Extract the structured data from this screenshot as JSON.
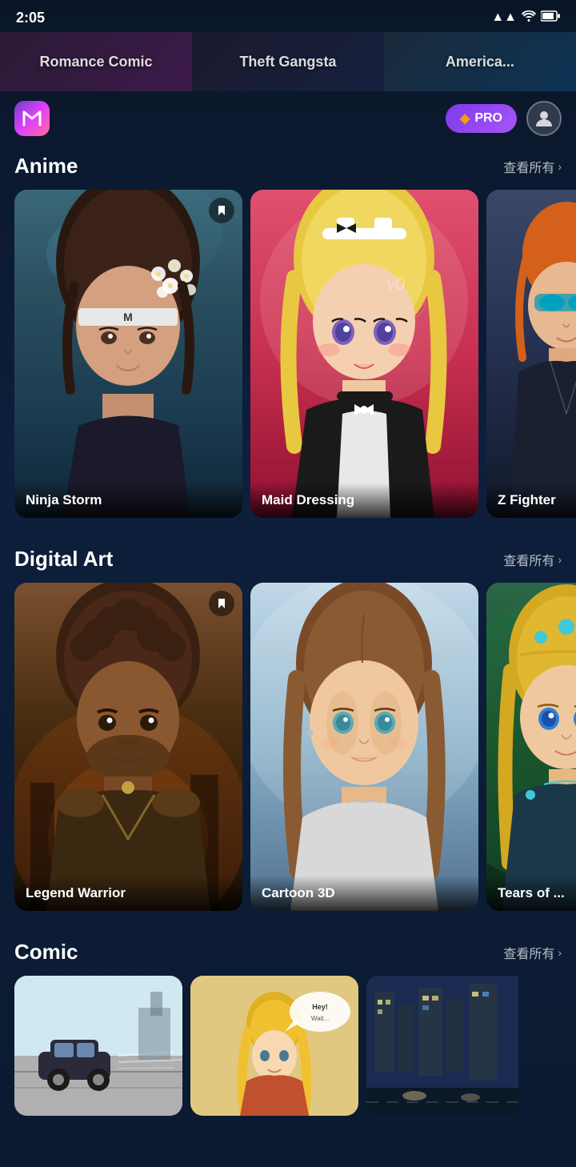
{
  "statusBar": {
    "time": "2:05",
    "signal": "▲",
    "wifi": "wifi",
    "battery": "🔋"
  },
  "topBanners": [
    {
      "label": "Romance Comic"
    },
    {
      "label": "Theft Gangsta"
    },
    {
      "label": "America..."
    }
  ],
  "header": {
    "logoText": "M",
    "proBadge": "PRO",
    "avatarLabel": "User"
  },
  "sections": [
    {
      "id": "anime",
      "title": "Anime",
      "viewAllLabel": "查看所有",
      "cards": [
        {
          "name": "Ninja Storm",
          "cardStyle": "ninja"
        },
        {
          "name": "Maid Dressing",
          "cardStyle": "maid"
        },
        {
          "name": "Z Fighter",
          "cardStyle": "zfighter"
        }
      ]
    },
    {
      "id": "digital-art",
      "title": "Digital Art",
      "viewAllLabel": "查看所有",
      "cards": [
        {
          "name": "Legend Warrior",
          "cardStyle": "legend"
        },
        {
          "name": "Cartoon 3D",
          "cardStyle": "cartoon3d"
        },
        {
          "name": "Tears of ...",
          "cardStyle": "tears"
        }
      ]
    },
    {
      "id": "comic",
      "title": "Comic",
      "viewAllLabel": "查看所有",
      "cards": [
        {
          "name": "",
          "cardStyle": "comic1"
        },
        {
          "name": "",
          "cardStyle": "comic2"
        },
        {
          "name": "",
          "cardStyle": "comic3"
        }
      ]
    }
  ]
}
